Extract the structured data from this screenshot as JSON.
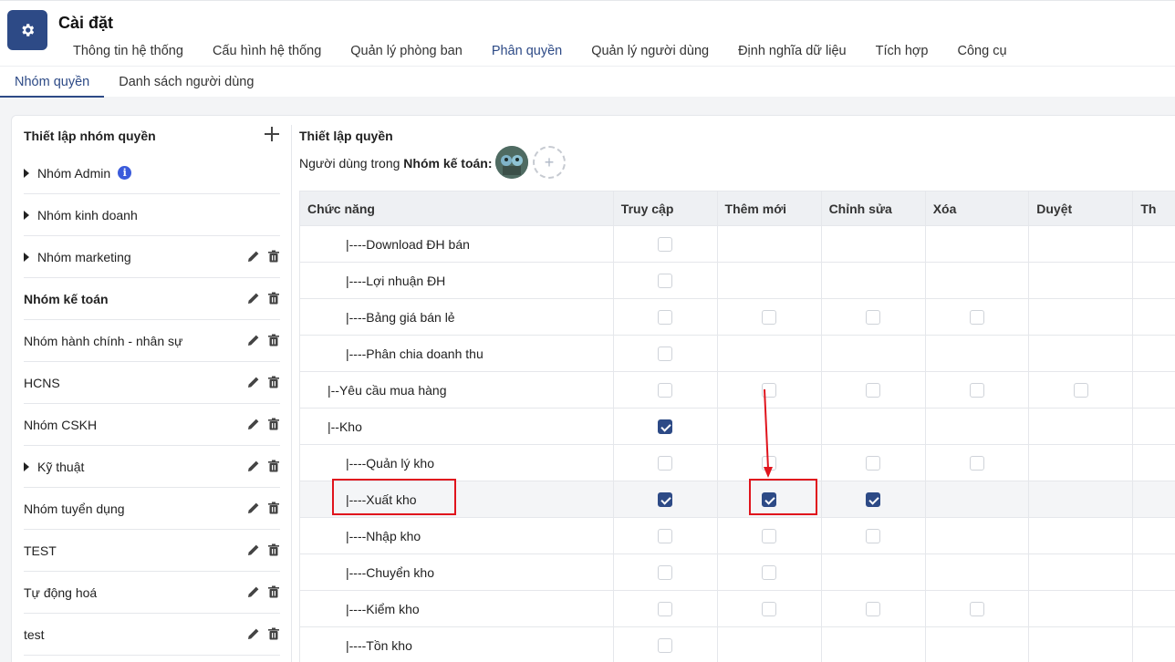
{
  "app": {
    "title": "Cài đặt",
    "icon": "gear-icon"
  },
  "main_tabs": [
    {
      "label": "Thông tin hệ thống",
      "active": false
    },
    {
      "label": "Cấu hình hệ thống",
      "active": false
    },
    {
      "label": "Quản lý phòng ban",
      "active": false
    },
    {
      "label": "Phân quyền",
      "active": true
    },
    {
      "label": "Quản lý người dùng",
      "active": false
    },
    {
      "label": "Định nghĩa dữ liệu",
      "active": false
    },
    {
      "label": "Tích hợp",
      "active": false
    },
    {
      "label": "Công cụ",
      "active": false
    }
  ],
  "sub_tabs": [
    {
      "label": "Nhóm quyền",
      "active": true
    },
    {
      "label": "Danh sách người dùng",
      "active": false
    }
  ],
  "left": {
    "title": "Thiết lập nhóm quyền",
    "groups": [
      {
        "label": "Nhóm Admin",
        "caret": true,
        "info": true,
        "actions": false,
        "bold": false
      },
      {
        "label": "Nhóm kinh doanh",
        "caret": true,
        "info": false,
        "actions": false,
        "bold": false
      },
      {
        "label": "Nhóm marketing",
        "caret": true,
        "info": false,
        "actions": true,
        "bold": false
      },
      {
        "label": "Nhóm kế toán",
        "caret": false,
        "info": false,
        "actions": true,
        "bold": true
      },
      {
        "label": "Nhóm hành chính - nhân sự",
        "caret": false,
        "info": false,
        "actions": true,
        "bold": false
      },
      {
        "label": "HCNS",
        "caret": false,
        "info": false,
        "actions": true,
        "bold": false
      },
      {
        "label": "Nhóm CSKH",
        "caret": false,
        "info": false,
        "actions": true,
        "bold": false
      },
      {
        "label": "Kỹ thuật",
        "caret": true,
        "info": false,
        "actions": true,
        "bold": false
      },
      {
        "label": "Nhóm tuyển dụng",
        "caret": false,
        "info": false,
        "actions": true,
        "bold": false
      },
      {
        "label": "TEST",
        "caret": false,
        "info": false,
        "actions": true,
        "bold": false
      },
      {
        "label": "Tự động hoá",
        "caret": false,
        "info": false,
        "actions": true,
        "bold": false
      },
      {
        "label": "test",
        "caret": false,
        "info": false,
        "actions": true,
        "bold": false
      }
    ]
  },
  "right": {
    "title": "Thiết lập quyền",
    "users_prefix": "Người dùng trong",
    "group_name": "Nhóm kế toán:",
    "add_user_symbol": "+"
  },
  "table": {
    "columns": [
      "Chức năng",
      "Truy cập",
      "Thêm mới",
      "Chỉnh sửa",
      "Xóa",
      "Duyệt",
      "Th"
    ],
    "rows": [
      {
        "name": "|----Download ĐH bán",
        "level": 2,
        "cells": [
          false,
          null,
          null,
          null,
          null,
          null
        ]
      },
      {
        "name": "|----Lợi nhuận ĐH",
        "level": 2,
        "cells": [
          false,
          null,
          null,
          null,
          null,
          null
        ]
      },
      {
        "name": "|----Bảng giá bán lẻ",
        "level": 2,
        "cells": [
          false,
          false,
          false,
          false,
          null,
          null
        ]
      },
      {
        "name": "|----Phân chia doanh thu",
        "level": 2,
        "cells": [
          false,
          null,
          null,
          null,
          null,
          null
        ]
      },
      {
        "name": "|--Yêu cầu mua hàng",
        "level": 1,
        "cells": [
          false,
          false,
          false,
          false,
          false,
          null
        ]
      },
      {
        "name": "|--Kho",
        "level": 1,
        "cells": [
          true,
          null,
          null,
          null,
          null,
          null
        ]
      },
      {
        "name": "|----Quản lý kho",
        "level": 2,
        "cells": [
          false,
          false,
          false,
          false,
          null,
          null
        ]
      },
      {
        "name": "|----Xuất kho",
        "level": 2,
        "cells": [
          true,
          true,
          true,
          null,
          null,
          null
        ],
        "highlight": true
      },
      {
        "name": "|----Nhập kho",
        "level": 2,
        "cells": [
          false,
          false,
          false,
          null,
          null,
          null
        ]
      },
      {
        "name": "|----Chuyển kho",
        "level": 2,
        "cells": [
          false,
          false,
          null,
          null,
          null,
          null
        ]
      },
      {
        "name": "|----Kiểm kho",
        "level": 2,
        "cells": [
          false,
          false,
          false,
          false,
          null,
          null
        ]
      },
      {
        "name": "|----Tồn kho",
        "level": 2,
        "cells": [
          false,
          null,
          null,
          null,
          null,
          null
        ]
      }
    ]
  },
  "colors": {
    "accent": "#2d4a86",
    "annotation": "#e0141d",
    "info": "#3b5bdb"
  }
}
